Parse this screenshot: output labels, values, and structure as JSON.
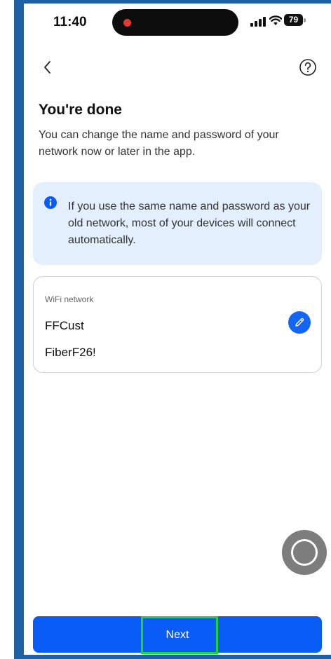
{
  "status_bar": {
    "time": "11:40",
    "battery": "79"
  },
  "nav": {
    "back_icon": "chevron-left-icon",
    "help_icon": "question-circle-icon"
  },
  "header": {
    "title": "You're done",
    "subtitle": "You can change the name and password of your network now or later in the app."
  },
  "info_banner": {
    "icon": "info-icon",
    "text": "If you use the same name and password as your old network, most of your devices will connect automatically."
  },
  "wifi_card": {
    "label": "WiFi network",
    "ssid": "FFCust",
    "password": "FiberF26!",
    "edit_icon": "pencil-icon"
  },
  "footer": {
    "next_label": "Next"
  },
  "colors": {
    "accent": "#0a5cf7",
    "banner_bg": "#e3effd",
    "highlight": "#1ed62a",
    "device_border": "#1f5fa3"
  }
}
